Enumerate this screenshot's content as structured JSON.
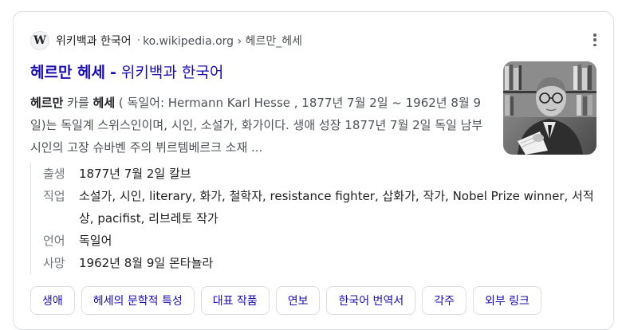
{
  "source": {
    "favicon_letter": "W",
    "site_name": "위키백과 한국어",
    "separator": "·",
    "url": "ko.wikipedia.org › 헤르만_헤세"
  },
  "result": {
    "title_main": "헤르만 헤세",
    "title_dash": "-",
    "title_site": "위키백과 한국어",
    "snippet_parts": {
      "p1": "헤르만",
      "p2": " 카를 ",
      "p3": "헤세",
      "p4": " ( 독일어: Hermann Karl Hesse , 1877년 7월 2일 ~ 1962년 8월 9일)는 독일계 스위스인이며, 시인, 소설가, 화가이다. 생애 성장 1877년 7월 2일 독일 남부 시인의 고장 슈바벤 주의 뷔르템베르크 소재 ..."
    },
    "thumbnail_icon": "portrait-photo"
  },
  "facts": [
    {
      "label": "출생",
      "value": "1877년 7월 2일 칼브"
    },
    {
      "label": "직업",
      "value": "소설가, 시인, literary, 화가, 철학자, resistance fighter, 삽화가, 작가, Nobel Prize winner, 서적상, pacifist, 리브레토 작가"
    },
    {
      "label": "언어",
      "value": "독일어"
    },
    {
      "label": "사망",
      "value": "1962년 8월 9일 몬타뇰라"
    }
  ],
  "chips": [
    "생애",
    "헤세의 문학적 특성",
    "대표 작품",
    "연보",
    "한국어 번역서",
    "각주",
    "외부 링크"
  ],
  "colors": {
    "link": "#1a0dab",
    "text": "#202124",
    "muted": "#4d5156",
    "label": "#70757a",
    "border": "#dadce0"
  }
}
